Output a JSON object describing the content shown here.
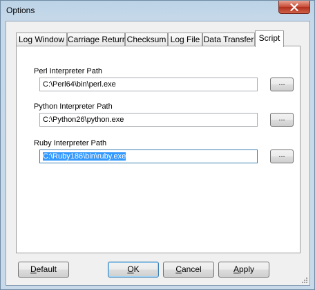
{
  "window": {
    "title": "Options"
  },
  "tabs": [
    {
      "label": "Log Window"
    },
    {
      "label": "Carriage Return"
    },
    {
      "label": "Checksum"
    },
    {
      "label": "Log File"
    },
    {
      "label": "Data Transfer"
    },
    {
      "label": "Script",
      "active": true
    }
  ],
  "script": {
    "perl": {
      "label": "Perl Interpreter Path",
      "value": "C:\\Perl64\\bin\\perl.exe",
      "browse": "..."
    },
    "python": {
      "label": "Python Interpreter Path",
      "value": "C:\\Python26\\python.exe",
      "browse": "..."
    },
    "ruby": {
      "label": "Ruby Interpreter Path",
      "value": "C:\\Ruby186\\bin\\ruby.exe",
      "browse": "...",
      "selected": true
    }
  },
  "buttons": {
    "default": {
      "accel": "D",
      "rest": "efault"
    },
    "ok": {
      "accel": "O",
      "rest": "K"
    },
    "cancel": {
      "accel": "C",
      "rest": "ancel"
    },
    "apply": {
      "accel": "A",
      "rest": "pply"
    }
  },
  "colors": {
    "close_button": "#c74a35",
    "selection": "#3399ff",
    "focus_border": "#3c7fb1"
  },
  "icons": {
    "close": "close-icon",
    "grip": "resize-grip-icon"
  }
}
